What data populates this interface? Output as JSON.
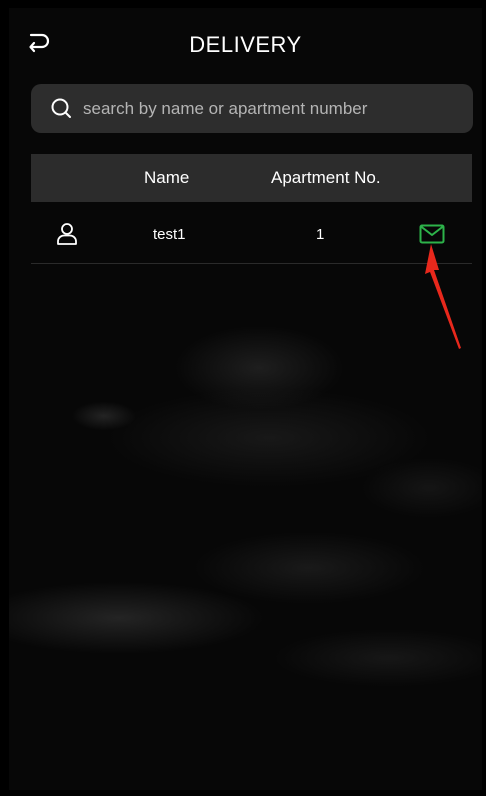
{
  "header": {
    "title": "DELIVERY",
    "back_icon": "back-arrow-icon"
  },
  "search": {
    "placeholder": "search by name or apartment number",
    "value": "",
    "icon": "search-icon"
  },
  "table": {
    "columns": [
      "Name",
      "Apartment No."
    ],
    "rows": [
      {
        "name": "test1",
        "apartment": "1",
        "icon": "user-icon",
        "action_icon": "mail-icon",
        "action_color": "#2db34a"
      }
    ]
  },
  "colors": {
    "background": "#070707",
    "surface": "#2c2c2c",
    "accent": "#2db34a",
    "annotation": "#e8281c"
  },
  "annotation": {
    "icon": "red-arrow-icon"
  }
}
